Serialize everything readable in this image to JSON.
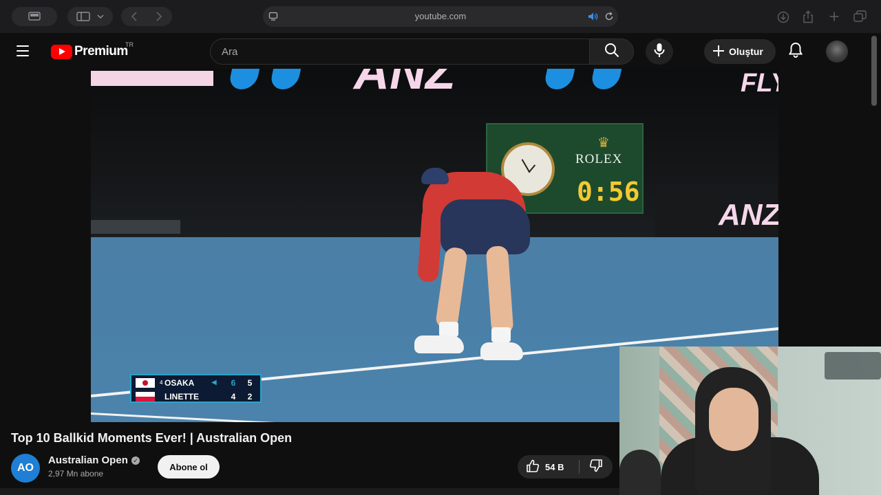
{
  "browser": {
    "url": "youtube.com",
    "icons": [
      "sidebar-icon",
      "chevron-down-icon",
      "back-icon",
      "forward-icon",
      "page-icon",
      "speaker-icon",
      "reload-icon",
      "download-icon",
      "share-icon",
      "new-tab-icon",
      "tabs-icon"
    ]
  },
  "header": {
    "logo_text": "Premium",
    "country": "TR",
    "search_placeholder": "Ara",
    "create_label": "Oluştur"
  },
  "video": {
    "board_brand": "ROLEX",
    "board_time": "0:56",
    "banner_text_left": "ANZ",
    "banner_text_right": "FLY",
    "court_text": "ANZ",
    "scoreboard": {
      "players": [
        {
          "seed": "4",
          "name": "OSAKA",
          "set1": "6",
          "game": "5",
          "serving": true
        },
        {
          "seed": "",
          "name": "LINETTE",
          "set1": "4",
          "game": "2",
          "serving": false
        }
      ]
    }
  },
  "details": {
    "title": "Top 10 Ballkid Moments Ever! | Australian Open",
    "channel_name": "Australian Open",
    "channel_avatar_text": "AO",
    "subscribers": "2,97 Mn abone",
    "subscribe_label": "Abone ol",
    "likes": "54 B"
  },
  "colors": {
    "background": "#0f0f0f",
    "youtube_red": "#ff0000",
    "court_blue": "#4b7fa6",
    "board_green": "#1d4a2c",
    "timer_yellow": "#f4c932"
  }
}
